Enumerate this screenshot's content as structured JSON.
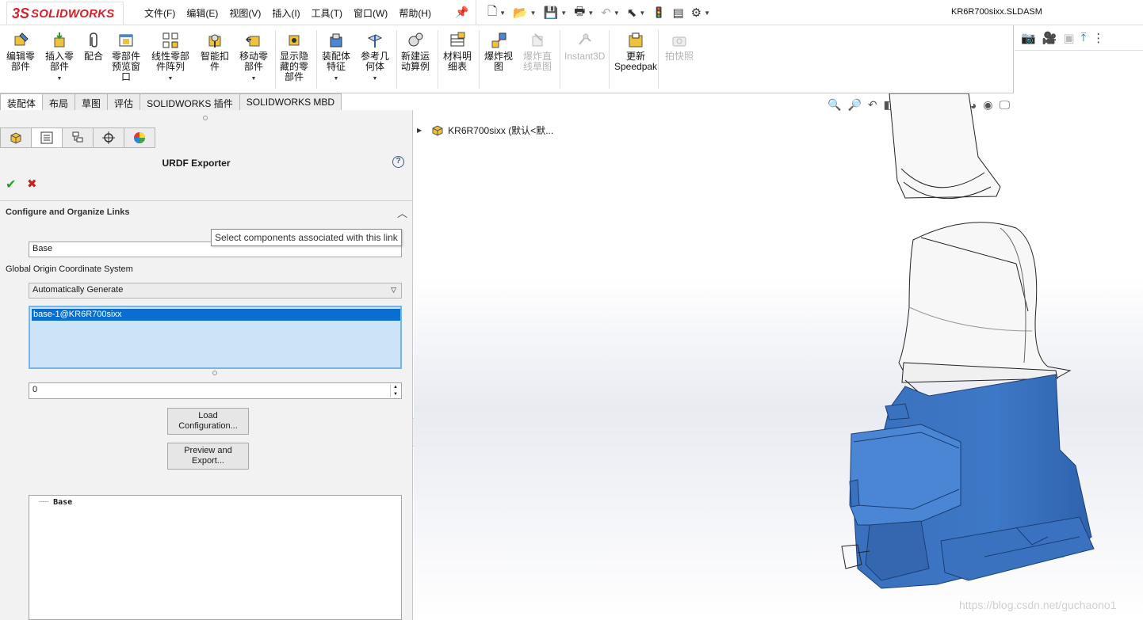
{
  "app": {
    "logo_text": "SOLIDWORKS",
    "document_title": "KR6R700sixx.SLDASM",
    "menus": [
      "文件(F)",
      "编辑(E)",
      "视图(V)",
      "插入(I)",
      "工具(T)",
      "窗口(W)",
      "帮助(H)"
    ]
  },
  "quick_access": [
    "new-document-icon",
    "open-icon",
    "save-icon",
    "print-icon",
    "undo-icon",
    "select-icon",
    "rebuild-icon",
    "file-properties-icon",
    "options-icon"
  ],
  "command_manager": {
    "items": [
      {
        "label": "编辑零\n部件",
        "has_dropdown": false,
        "enabled": true
      },
      {
        "label": "插入零\n部件",
        "has_dropdown": true,
        "enabled": true
      },
      {
        "label": "配合",
        "has_dropdown": false,
        "enabled": true
      },
      {
        "label": "零部件\n预览窗\n口",
        "has_dropdown": false,
        "enabled": true
      },
      {
        "label": "线性零部\n件阵列",
        "has_dropdown": true,
        "enabled": true
      },
      {
        "label": "智能扣\n件",
        "has_dropdown": false,
        "enabled": true
      },
      {
        "label": "移动零\n部件",
        "has_dropdown": true,
        "enabled": true
      },
      {
        "label": "显示隐\n藏的零\n部件",
        "has_dropdown": false,
        "enabled": true
      },
      {
        "label": "装配体\n特征",
        "has_dropdown": true,
        "enabled": true
      },
      {
        "label": "参考几\n何体",
        "has_dropdown": true,
        "enabled": true
      },
      {
        "label": "新建运\n动算例",
        "has_dropdown": false,
        "enabled": true
      },
      {
        "label": "材料明\n细表",
        "has_dropdown": false,
        "enabled": true
      },
      {
        "label": "爆炸视\n图",
        "has_dropdown": false,
        "enabled": true
      },
      {
        "label": "爆炸直\n线草图",
        "has_dropdown": false,
        "enabled": false
      },
      {
        "label": "Instant3D",
        "has_dropdown": false,
        "enabled": false
      },
      {
        "label": "更新\nSpeedpak",
        "has_dropdown": false,
        "enabled": true
      },
      {
        "label": "拍快照",
        "has_dropdown": false,
        "enabled": false
      }
    ]
  },
  "tabs": [
    {
      "label": "装配体",
      "active": true
    },
    {
      "label": "布局",
      "active": false
    },
    {
      "label": "草图",
      "active": false
    },
    {
      "label": "评估",
      "active": false
    },
    {
      "label": "SOLIDWORKS 插件",
      "active": false
    },
    {
      "label": "SOLIDWORKS MBD",
      "active": false
    }
  ],
  "property_manager": {
    "tabs": [
      "feature-manager-icon",
      "property-manager-icon",
      "configuration-manager-icon",
      "dimxpert-icon",
      "display-manager-icon"
    ],
    "title": "URDF Exporter",
    "group_header": "Configure and Organize Links",
    "link_name": "Base",
    "coord_label": "Global Origin Coordinate System",
    "coord_value": "Automatically Generate",
    "selected_component": "base-1@KR6R700sixx",
    "tooltip": "Select components associated with this link",
    "child_count": "0",
    "load_button": "Load\nConfiguration...",
    "preview_button": "Preview and\nExport...",
    "tree_item": "Base"
  },
  "viewport": {
    "tree_root_label": "KR6R700sixx  (默认<默...",
    "watermark": "https://blog.csdn.net/guchaono1",
    "robot_blue": "#3d78c6",
    "robot_white": "#f7f7f7"
  }
}
